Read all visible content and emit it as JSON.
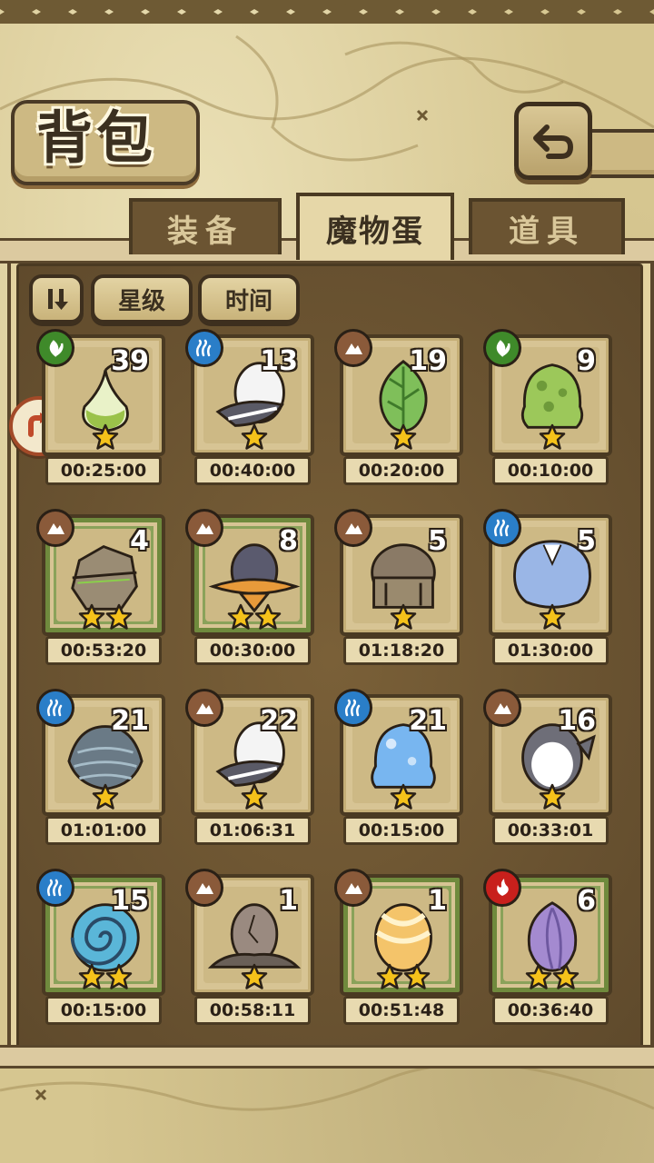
{
  "header": {
    "title": "背包"
  },
  "tabs": [
    {
      "label": "装备",
      "active": false
    },
    {
      "label": "魔物蛋",
      "active": true
    },
    {
      "label": "道具",
      "active": false
    }
  ],
  "sort": {
    "star_label": "星级",
    "time_label": "时间"
  },
  "colors": {
    "nature": "#3f8a2a",
    "water": "#2a7ec8",
    "earth": "#8a5a3a",
    "fire": "#c8201c",
    "star": "#f5c21a"
  },
  "eggs": [
    {
      "count": "39",
      "time": "00:25:00",
      "element": "nature",
      "stars": 1,
      "frame": "normal",
      "icon": "bulb-egg-icon"
    },
    {
      "count": "13",
      "time": "00:40:00",
      "element": "water",
      "stars": 1,
      "frame": "normal",
      "icon": "feather-egg-icon"
    },
    {
      "count": "19",
      "time": "00:20:00",
      "element": "earth",
      "stars": 1,
      "frame": "normal",
      "icon": "leaf-egg-icon"
    },
    {
      "count": "9",
      "time": "00:10:00",
      "element": "nature",
      "stars": 1,
      "frame": "normal",
      "icon": "slime-egg-icon"
    },
    {
      "count": "4",
      "time": "00:53:20",
      "element": "earth",
      "stars": 2,
      "frame": "green",
      "icon": "rock-egg-icon"
    },
    {
      "count": "8",
      "time": "00:30:00",
      "element": "earth",
      "stars": 2,
      "frame": "green",
      "icon": "hat-egg-icon"
    },
    {
      "count": "5",
      "time": "01:18:20",
      "element": "earth",
      "stars": 1,
      "frame": "normal",
      "icon": "helmet-egg-icon"
    },
    {
      "count": "5",
      "time": "01:30:00",
      "element": "water",
      "stars": 1,
      "frame": "normal",
      "icon": "fluffy-egg-icon"
    },
    {
      "count": "21",
      "time": "01:01:00",
      "element": "water",
      "stars": 1,
      "frame": "normal",
      "icon": "shell-egg-icon"
    },
    {
      "count": "22",
      "time": "01:06:31",
      "element": "earth",
      "stars": 1,
      "frame": "normal",
      "icon": "feather-egg-icon"
    },
    {
      "count": "21",
      "time": "00:15:00",
      "element": "water",
      "stars": 1,
      "frame": "normal",
      "icon": "water-slime-egg-icon"
    },
    {
      "count": "16",
      "time": "00:33:01",
      "element": "earth",
      "stars": 1,
      "frame": "normal",
      "icon": "penguin-egg-icon"
    },
    {
      "count": "15",
      "time": "00:15:00",
      "element": "water",
      "stars": 2,
      "frame": "green",
      "icon": "spiral-shell-egg-icon"
    },
    {
      "count": "1",
      "time": "00:58:11",
      "element": "earth",
      "stars": 1,
      "frame": "normal",
      "icon": "stone-egg-icon"
    },
    {
      "count": "1",
      "time": "00:51:48",
      "element": "earth",
      "stars": 2,
      "frame": "green",
      "icon": "golden-egg-icon"
    },
    {
      "count": "6",
      "time": "00:36:40",
      "element": "fire",
      "stars": 2,
      "frame": "green",
      "icon": "flower-bud-egg-icon"
    }
  ]
}
